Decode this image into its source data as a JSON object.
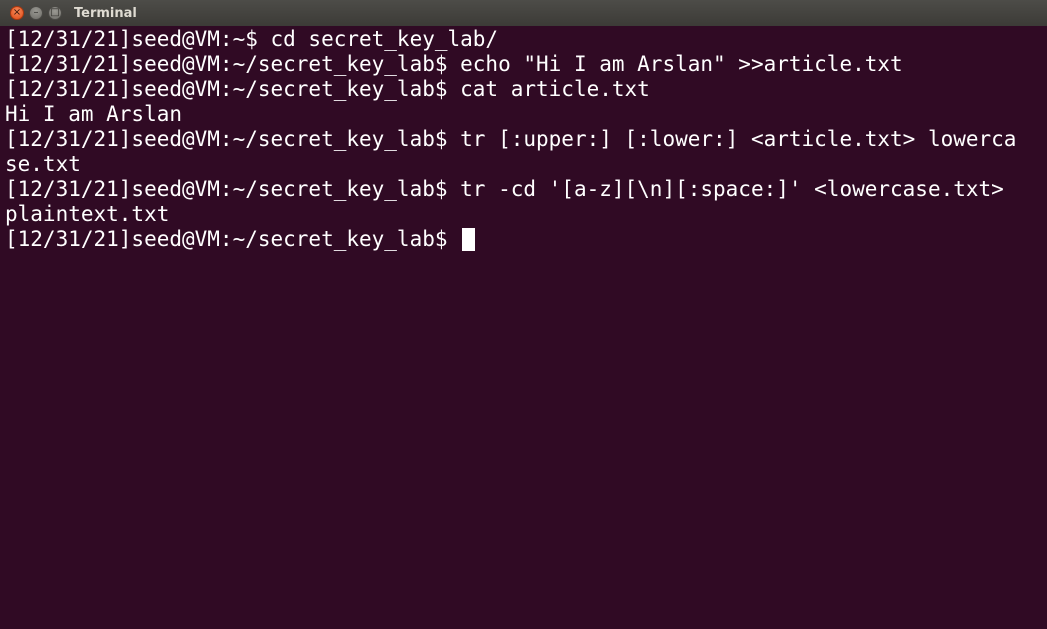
{
  "window": {
    "title": "Terminal"
  },
  "terminal": {
    "lines": [
      "[12/31/21]seed@VM:~$ cd secret_key_lab/",
      "[12/31/21]seed@VM:~/secret_key_lab$ echo \"Hi I am Arslan\" >>article.txt",
      "[12/31/21]seed@VM:~/secret_key_lab$ cat article.txt",
      "Hi I am Arslan",
      "[12/31/21]seed@VM:~/secret_key_lab$ tr [:upper:] [:lower:] <article.txt> lowerca",
      "se.txt",
      "[12/31/21]seed@VM:~/secret_key_lab$ tr -cd '[a-z][\\n][:space:]' <lowercase.txt>",
      "plaintext.txt"
    ],
    "prompt": "[12/31/21]seed@VM:~/secret_key_lab$ "
  },
  "colors": {
    "background": "#300a24",
    "foreground": "#ffffff",
    "titlebar": "#3c3b37",
    "close_button": "#df4a16"
  }
}
